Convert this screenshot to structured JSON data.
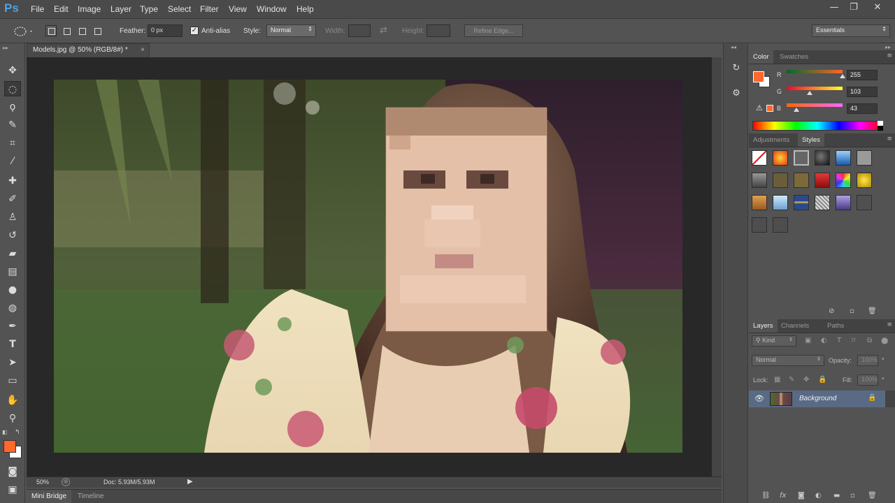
{
  "app": {
    "logo": "Ps"
  },
  "menu": [
    "File",
    "Edit",
    "Image",
    "Layer",
    "Type",
    "Select",
    "Filter",
    "View",
    "Window",
    "Help"
  ],
  "window_controls": {
    "minimize": "—",
    "restore": "❐",
    "close": "✕"
  },
  "options": {
    "feather_label": "Feather:",
    "feather_value": "0 px",
    "antialias_label": "Anti-alias",
    "antialias_checked": true,
    "style_label": "Style:",
    "style_value": "Normal",
    "width_label": "Width:",
    "height_label": "Height:",
    "refine_edge": "Refine Edge...",
    "workspace": "Essentials"
  },
  "document": {
    "tab_title": "Models.jpg @ 50% (RGB/8#) *",
    "zoom": "50%",
    "doc_size": "Doc: 5.93M/5.93M",
    "close": "×"
  },
  "bottom_tabs": [
    "Mini Bridge",
    "Timeline"
  ],
  "color_panel": {
    "tabs": [
      "Color",
      "Swatches"
    ],
    "r_label": "R",
    "r_value": "255",
    "g_label": "G",
    "g_value": "103",
    "b_label": "B",
    "b_value": "43",
    "foreground_color": "#ff672b",
    "background_color": "#ffffff"
  },
  "styles_panel": {
    "tabs": [
      "Adjustments",
      "Styles"
    ]
  },
  "layers_panel": {
    "tabs": [
      "Layers",
      "Channels",
      "Paths"
    ],
    "kind_label": "Kind",
    "blend_mode": "Normal",
    "opacity_label": "Opacity:",
    "opacity_value": "100%",
    "lock_label": "Lock:",
    "fill_label": "Fill:",
    "fill_value": "100%",
    "layer_name": "Background"
  },
  "icons": {
    "tools": [
      "move-icon",
      "elliptical-marquee-icon",
      "lasso-icon",
      "quick-selection-icon",
      "crop-icon",
      "eyedropper-icon",
      "healing-brush-icon",
      "brush-icon",
      "clone-stamp-icon",
      "history-brush-icon",
      "eraser-icon",
      "gradient-icon",
      "blur-icon",
      "dodge-icon",
      "pen-icon",
      "type-icon",
      "path-selection-icon",
      "rectangle-icon",
      "hand-icon",
      "zoom-icon"
    ]
  }
}
